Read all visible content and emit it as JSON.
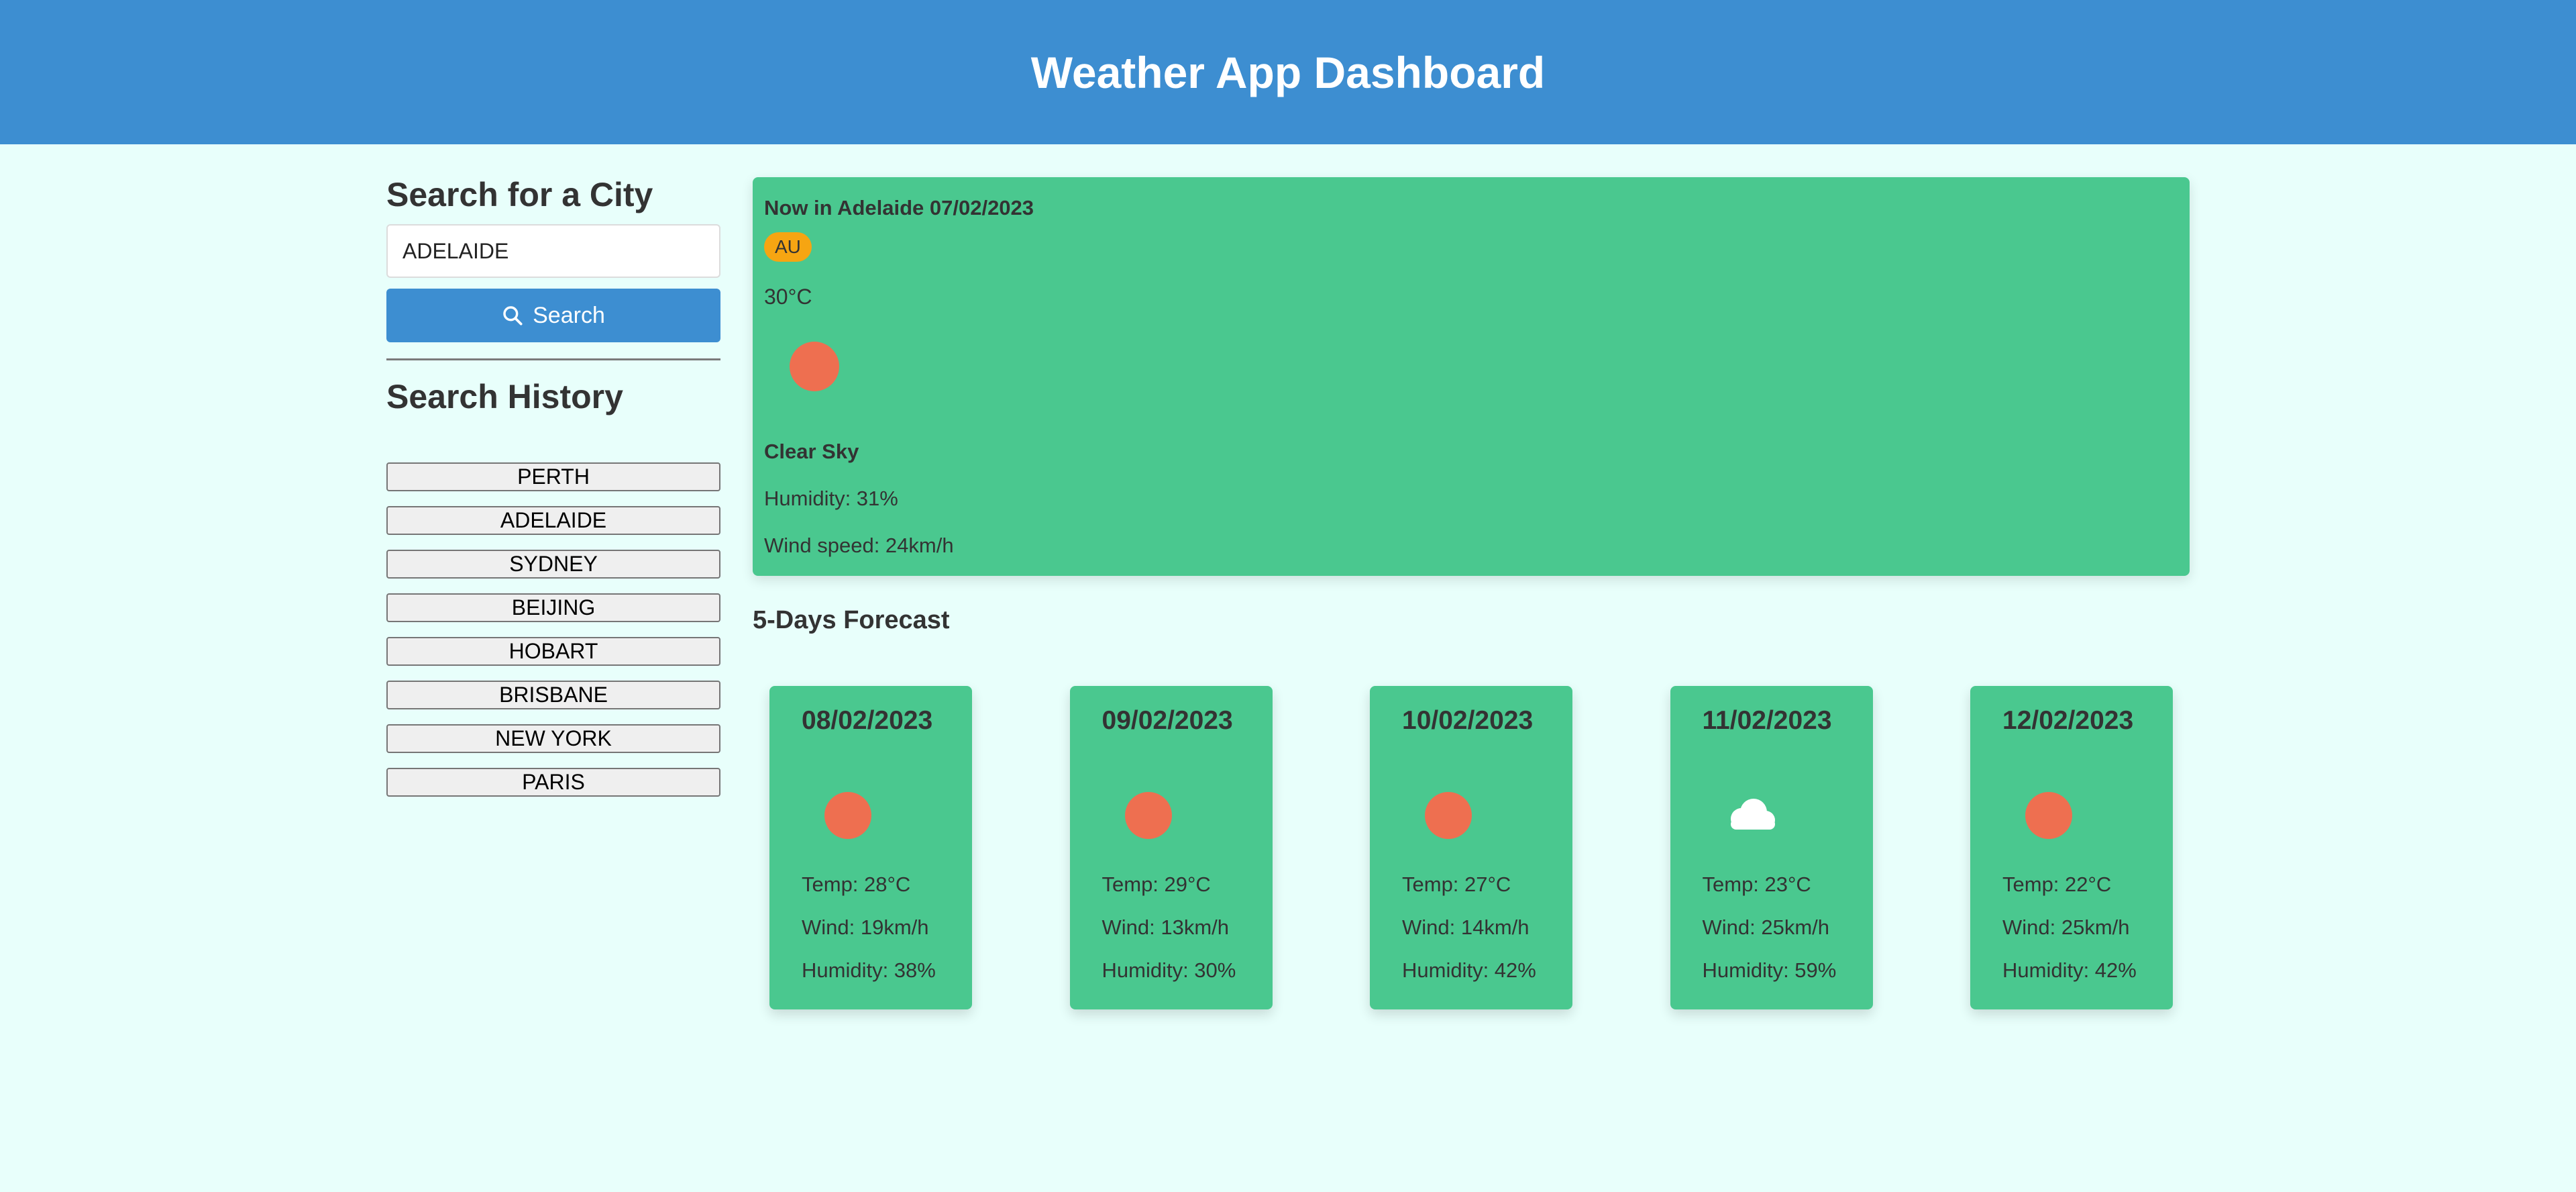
{
  "header": {
    "title": "Weather App Dashboard"
  },
  "sidebar": {
    "search_title": "Search for a City",
    "search_value": "ADELAIDE",
    "search_button": "Search",
    "history_title": "Search History",
    "history": [
      "PERTH",
      "ADELAIDE",
      "SYDNEY",
      "BEIJING",
      "HOBART",
      "BRISBANE",
      "NEW YORK",
      "PARIS"
    ]
  },
  "current": {
    "heading": "Now in Adelaide 07/02/2023",
    "country": "AU",
    "temp": "30°C",
    "icon": "sun-icon",
    "description": "Clear Sky",
    "humidity": "Humidity: 31%",
    "wind": "Wind speed: 24km/h"
  },
  "forecast": {
    "title": "5-Days Forecast",
    "days": [
      {
        "date": "08/02/2023",
        "icon": "sun-icon",
        "temp": "Temp: 28°C",
        "wind": "Wind: 19km/h",
        "humidity": "Humidity: 38%"
      },
      {
        "date": "09/02/2023",
        "icon": "sun-icon",
        "temp": "Temp: 29°C",
        "wind": "Wind: 13km/h",
        "humidity": "Humidity: 30%"
      },
      {
        "date": "10/02/2023",
        "icon": "sun-icon",
        "temp": "Temp: 27°C",
        "wind": "Wind: 14km/h",
        "humidity": "Humidity: 42%"
      },
      {
        "date": "11/02/2023",
        "icon": "cloud-icon",
        "temp": "Temp: 23°C",
        "wind": "Wind: 25km/h",
        "humidity": "Humidity: 59%"
      },
      {
        "date": "12/02/2023",
        "icon": "sun-icon",
        "temp": "Temp: 22°C",
        "wind": "Wind: 25km/h",
        "humidity": "Humidity: 42%"
      }
    ]
  },
  "colors": {
    "header_bg": "#3d8ed1",
    "page_bg": "#e8fffb",
    "card_bg": "#4ac88f",
    "sun": "#ee6f50",
    "badge": "#f6a512"
  }
}
